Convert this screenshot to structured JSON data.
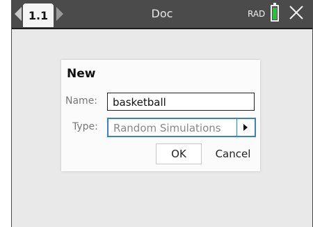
{
  "titlebar": {
    "tab_label": "1.1",
    "document_title": "Doc",
    "angle_mode": "RAD",
    "battery_color": "#2ebd40",
    "icons": [
      "chevron-left-icon",
      "chevron-right-icon",
      "battery-icon",
      "close-icon"
    ]
  },
  "dialog": {
    "title": "New",
    "name_label": "Name:",
    "name_value": "basketball",
    "type_label": "Type:",
    "type_value": "Random Simulations",
    "ok_label": "OK",
    "cancel_label": "Cancel",
    "accent_color": "#3b7fc4"
  }
}
